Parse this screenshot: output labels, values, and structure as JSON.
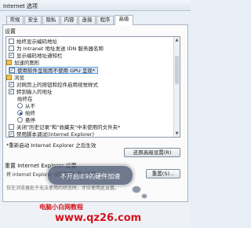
{
  "window": {
    "title": "Internet 选项"
  },
  "tabs": [
    {
      "label": "常规"
    },
    {
      "label": "安全"
    },
    {
      "label": "隐私"
    },
    {
      "label": "内容"
    },
    {
      "label": "连接"
    },
    {
      "label": "程序"
    },
    {
      "label": "高级"
    }
  ],
  "settings": {
    "legend": "设置",
    "items": [
      {
        "type": "checkbox",
        "checked": false,
        "label": "始终显示编码地址"
      },
      {
        "type": "checkbox",
        "checked": false,
        "label": "为 Intranet 地址发送 IDN 服务器名称"
      },
      {
        "type": "checkbox",
        "checked": true,
        "label": "显示编码地址通知栏"
      },
      {
        "type": "group",
        "label": "加速的图形"
      },
      {
        "type": "checkbox",
        "checked": true,
        "label": "使用软件呈现而不使用 GPU 呈现*"
      },
      {
        "type": "group",
        "label": "浏览"
      },
      {
        "type": "checkbox",
        "checked": true,
        "label": "对网页上的按钮和控件启用视觉样式"
      },
      {
        "type": "checkbox",
        "checked": true,
        "label": "转到输入的地址"
      },
      {
        "type": "radio-label",
        "label": "始终在"
      },
      {
        "type": "radio",
        "checked": false,
        "label": "从不"
      },
      {
        "type": "radio",
        "checked": true,
        "label": "始终"
      },
      {
        "type": "radio",
        "checked": false,
        "label": "悬停"
      },
      {
        "type": "checkbox",
        "checked": false,
        "label": "关闭\"历史记录\"和\"收藏夹\"中未使用的文件夹*"
      },
      {
        "type": "checkbox",
        "checked": true,
        "label": "禁用脚本调试(Internet Explorer)"
      }
    ],
    "note": "*重新启动 Internet Explorer 之后生效",
    "restore_button": "还原高级设置(R)"
  },
  "reset": {
    "label": "重置 Internet Explorer 设置",
    "description": "将 Internet Explorer 设置重置为默认设置。",
    "button": "重置(S)...",
    "note": "仅在浏览器处于无法使用的状态时，才应使用此设置。"
  },
  "callout": {
    "text": "不开启IE9的硬件加速"
  },
  "watermark": {
    "line1": "电脑小白网教程",
    "url": "www.qz26.com"
  },
  "colors": {
    "watermark": "#d4141c",
    "callout": "#46556e"
  }
}
